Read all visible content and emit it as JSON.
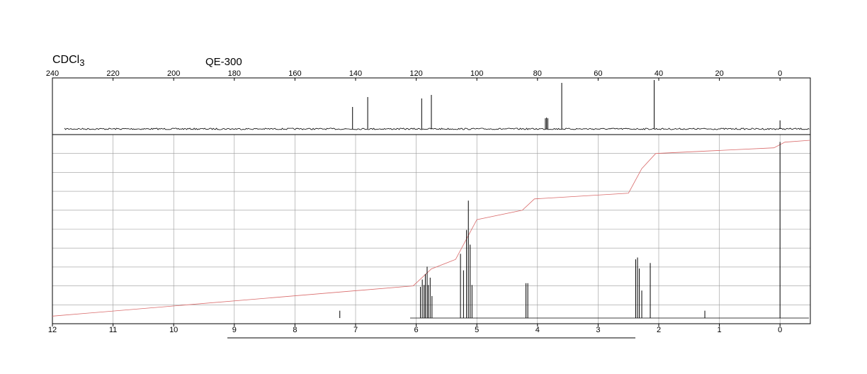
{
  "labels": {
    "solvent_prefix": "CDCl",
    "solvent_sub": "3",
    "instrument": "QE-300"
  },
  "chart_data": [
    {
      "type": "line",
      "name": "13C NMR spectrum",
      "xlim": [
        240,
        -10
      ],
      "x_ticks": [
        240,
        220,
        200,
        180,
        160,
        140,
        120,
        100,
        80,
        60,
        40,
        20,
        0
      ],
      "grid": false,
      "peaks": [
        {
          "x": 141.0,
          "h": 0.62
        },
        {
          "x": 136.0,
          "h": 0.9
        },
        {
          "x": 118.2,
          "h": 0.86
        },
        {
          "x": 115.0,
          "h": 0.96
        },
        {
          "x": 77.4,
          "h": 0.3
        },
        {
          "x": 77.0,
          "h": 0.32
        },
        {
          "x": 76.6,
          "h": 0.3
        },
        {
          "x": 72.0,
          "h": 1.3
        },
        {
          "x": 41.5,
          "h": 1.38
        },
        {
          "x": 0.0,
          "h": 0.24
        }
      ]
    },
    {
      "type": "line",
      "name": "1H NMR spectrum",
      "xlim": [
        12,
        -0.5
      ],
      "x_ticks": [
        12,
        11,
        10,
        9,
        8,
        7,
        6,
        5,
        4,
        3,
        2,
        1,
        0
      ],
      "grid": true,
      "peaks": [
        {
          "x": 7.26,
          "h": 0.04
        },
        {
          "x": 5.93,
          "h": 0.17
        },
        {
          "x": 5.9,
          "h": 0.21
        },
        {
          "x": 5.87,
          "h": 0.18
        },
        {
          "x": 5.85,
          "h": 0.24
        },
        {
          "x": 5.82,
          "h": 0.28
        },
        {
          "x": 5.8,
          "h": 0.18
        },
        {
          "x": 5.77,
          "h": 0.22
        },
        {
          "x": 5.74,
          "h": 0.12
        },
        {
          "x": 5.27,
          "h": 0.35
        },
        {
          "x": 5.22,
          "h": 0.26
        },
        {
          "x": 5.17,
          "h": 0.48
        },
        {
          "x": 5.14,
          "h": 0.64
        },
        {
          "x": 5.11,
          "h": 0.4
        },
        {
          "x": 5.08,
          "h": 0.18
        },
        {
          "x": 4.19,
          "h": 0.19
        },
        {
          "x": 4.16,
          "h": 0.19
        },
        {
          "x": 2.38,
          "h": 0.32
        },
        {
          "x": 2.35,
          "h": 0.33
        },
        {
          "x": 2.32,
          "h": 0.27
        },
        {
          "x": 2.28,
          "h": 0.15
        },
        {
          "x": 2.14,
          "h": 0.3
        },
        {
          "x": 1.24,
          "h": 0.04
        },
        {
          "x": 0.0,
          "h": 0.96
        }
      ],
      "integral": [
        {
          "x": 12.0,
          "y": 0.04
        },
        {
          "x": 6.05,
          "y": 0.2
        },
        {
          "x": 5.75,
          "y": 0.29
        },
        {
          "x": 5.35,
          "y": 0.34
        },
        {
          "x": 5.0,
          "y": 0.55
        },
        {
          "x": 4.25,
          "y": 0.6
        },
        {
          "x": 4.05,
          "y": 0.66
        },
        {
          "x": 2.5,
          "y": 0.69
        },
        {
          "x": 2.28,
          "y": 0.82
        },
        {
          "x": 2.05,
          "y": 0.9
        },
        {
          "x": 0.1,
          "y": 0.93
        },
        {
          "x": -0.08,
          "y": 0.96
        },
        {
          "x": -0.5,
          "y": 0.97
        }
      ]
    }
  ]
}
